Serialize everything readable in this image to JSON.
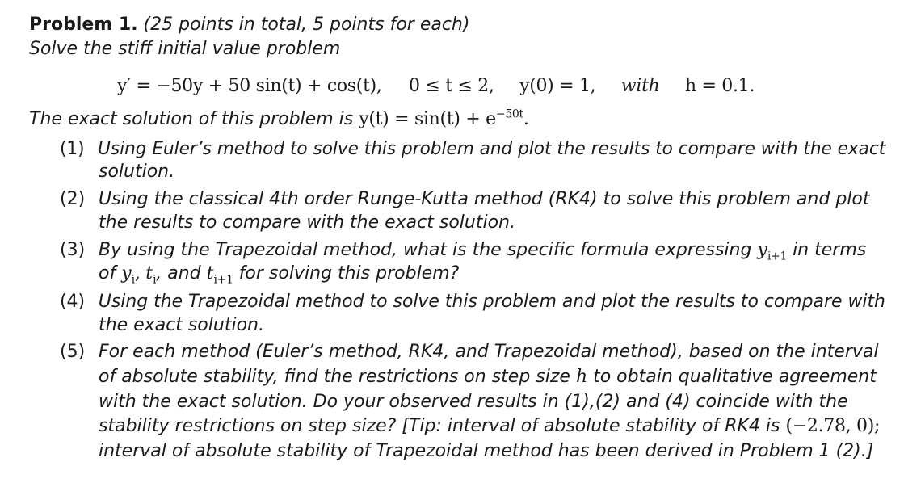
{
  "header": {
    "title": "Problem 1.",
    "points_note": "(25 points in total, 5 points for each)",
    "intro": "Solve the stiff initial value problem"
  },
  "equation": {
    "ode": "y′ = −50y + 50 sin(t) + cos(t),",
    "interval": "0 ≤ t ≤ 2,",
    "initial_condition": "y(0) = 1,",
    "with_word": "with",
    "step": "h = 0.1."
  },
  "exact": {
    "prefix": "The exact solution of this problem is ",
    "formula": "y(t) = sin(t) + e",
    "exponent": "−50t",
    "suffix": "."
  },
  "items": [
    {
      "number": "(1)",
      "lines": [
        "Using Euler’s method to solve this problem and plot the results to compare with the exact",
        "solution."
      ]
    },
    {
      "number": "(2)",
      "lines": [
        "Using the classical 4th order Runge-Kutta method (RK4) to solve this problem and plot",
        "the results to compare with the exact solution."
      ]
    },
    {
      "number": "(3)",
      "line1_text": "By using the Trapezoidal method, what is the specific formula expressing ",
      "line1_var": "y",
      "line1_sub": "i+1",
      "line1_tail": " in terms",
      "line2_of": "of ",
      "line2_y": "y",
      "line2_y_sub": "i",
      "line2_t": "t",
      "line2_t_sub": "i",
      "line2_and": ", and ",
      "line2_t2": "t",
      "line2_t2_sub": "i+1",
      "line2_tail": " for solving this problem?"
    },
    {
      "number": "(4)",
      "lines": [
        "Using the Trapezoidal method to solve this problem and plot the results to compare with",
        "the exact solution."
      ]
    },
    {
      "number": "(5)",
      "lines": [
        "For each method (Euler’s method, RK4, and Trapezoidal method), based on the interval",
        "of absolute stability, find the restrictions on step size ",
        "with the exact solution.  Do your observed results in (1),(2) and (4) coincide with the",
        "stability restrictions on step size? [Tip: interval of absolute stability of RK4 is ",
        "interval of absolute stability of Trapezoidal method has been derived in Problem 1 (2).]"
      ],
      "h_var": "h",
      "line2_tail": " to obtain qualitative agreement",
      "rk4_interval": "(−2.78, 0);"
    }
  ]
}
